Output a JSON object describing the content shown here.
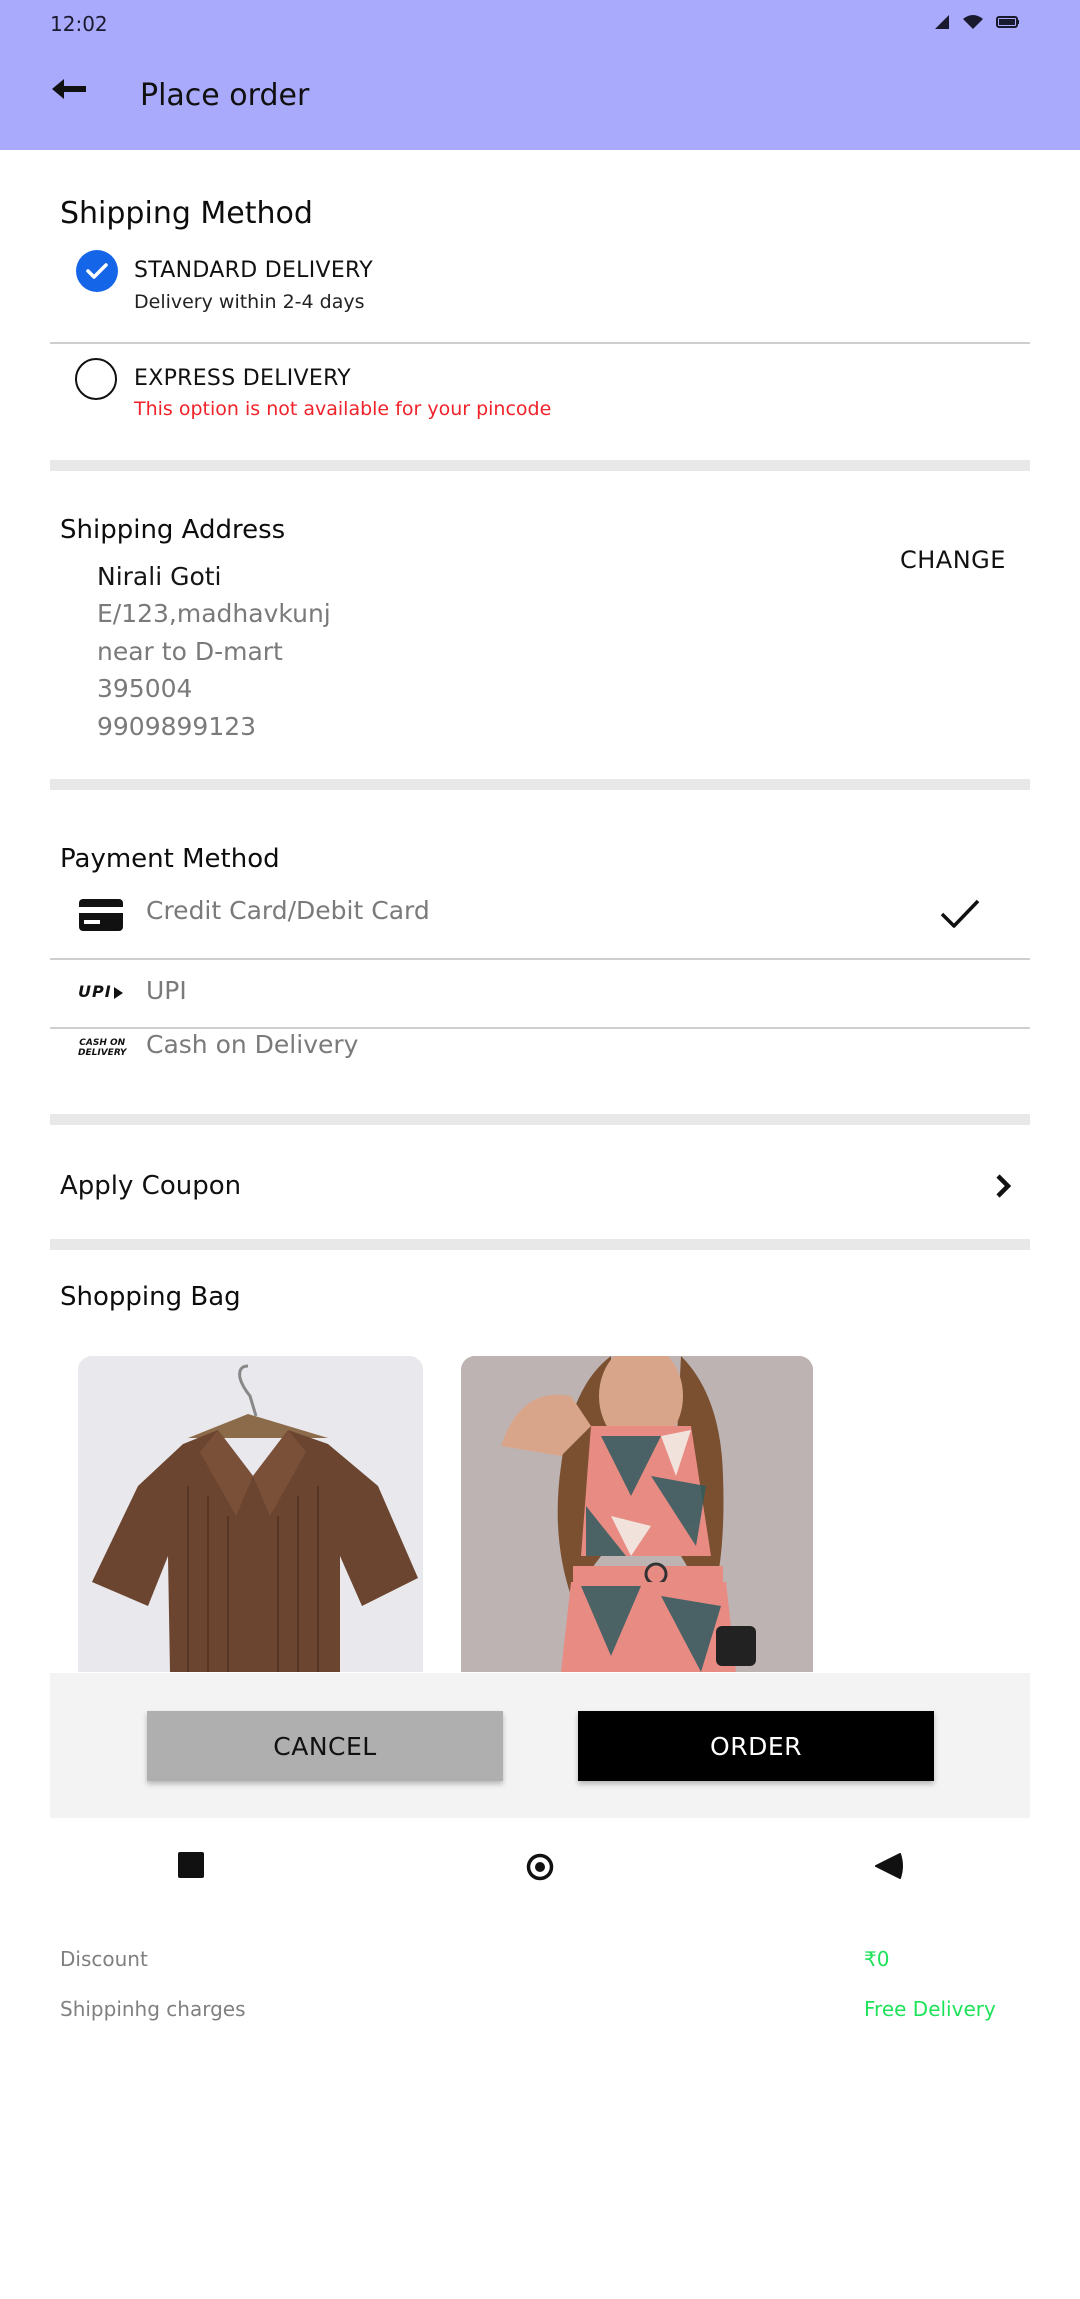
{
  "status_bar": {
    "time": "12:02"
  },
  "header": {
    "title": "Place order"
  },
  "shipping_method": {
    "title": "Shipping Method",
    "options": [
      {
        "label": "STANDARD DELIVERY",
        "subtitle": "Delivery within 2-4 days",
        "selected": true
      },
      {
        "label": "EXPRESS DELIVERY",
        "subtitle": "This option is not available for your pincode",
        "selected": false
      }
    ]
  },
  "shipping_address": {
    "title": "Shipping Address",
    "change_label": "CHANGE",
    "name": "Nirali Goti",
    "lines": [
      "E/123,madhavkunj",
      "near to D-mart",
      "395004",
      "9909899123"
    ]
  },
  "payment_method": {
    "title": "Payment Method",
    "options": [
      {
        "label": "Credit Card/Debit Card",
        "icon": "credit-card-icon",
        "selected": true
      },
      {
        "label": "UPI",
        "icon": "upi-logo-icon",
        "selected": false
      },
      {
        "label": "Cash on Delivery",
        "icon": "cash-on-delivery-icon",
        "selected": false
      }
    ],
    "upi_logo_text": "UPI",
    "cod_logo_text": [
      "CASH ON",
      "DELIVERY"
    ]
  },
  "coupon": {
    "label": "Apply Coupon"
  },
  "shopping_bag": {
    "title": "Shopping Bag",
    "items": [
      {
        "description": "brown ribbed collared short-sleeve top"
      },
      {
        "description": "plaid halter crop top and skirt set"
      }
    ]
  },
  "actions": {
    "cancel_label": "CANCEL",
    "order_label": "ORDER"
  },
  "summary": {
    "rows": [
      {
        "label": "Discount",
        "value": "₹0"
      },
      {
        "label": "Shippinhg charges",
        "value": "Free Delivery"
      }
    ]
  },
  "colors": {
    "appbar": "#aaaafd",
    "radio_selected": "#1565e8",
    "warning": "#f0222a",
    "summary_value": "#1ee35a"
  }
}
